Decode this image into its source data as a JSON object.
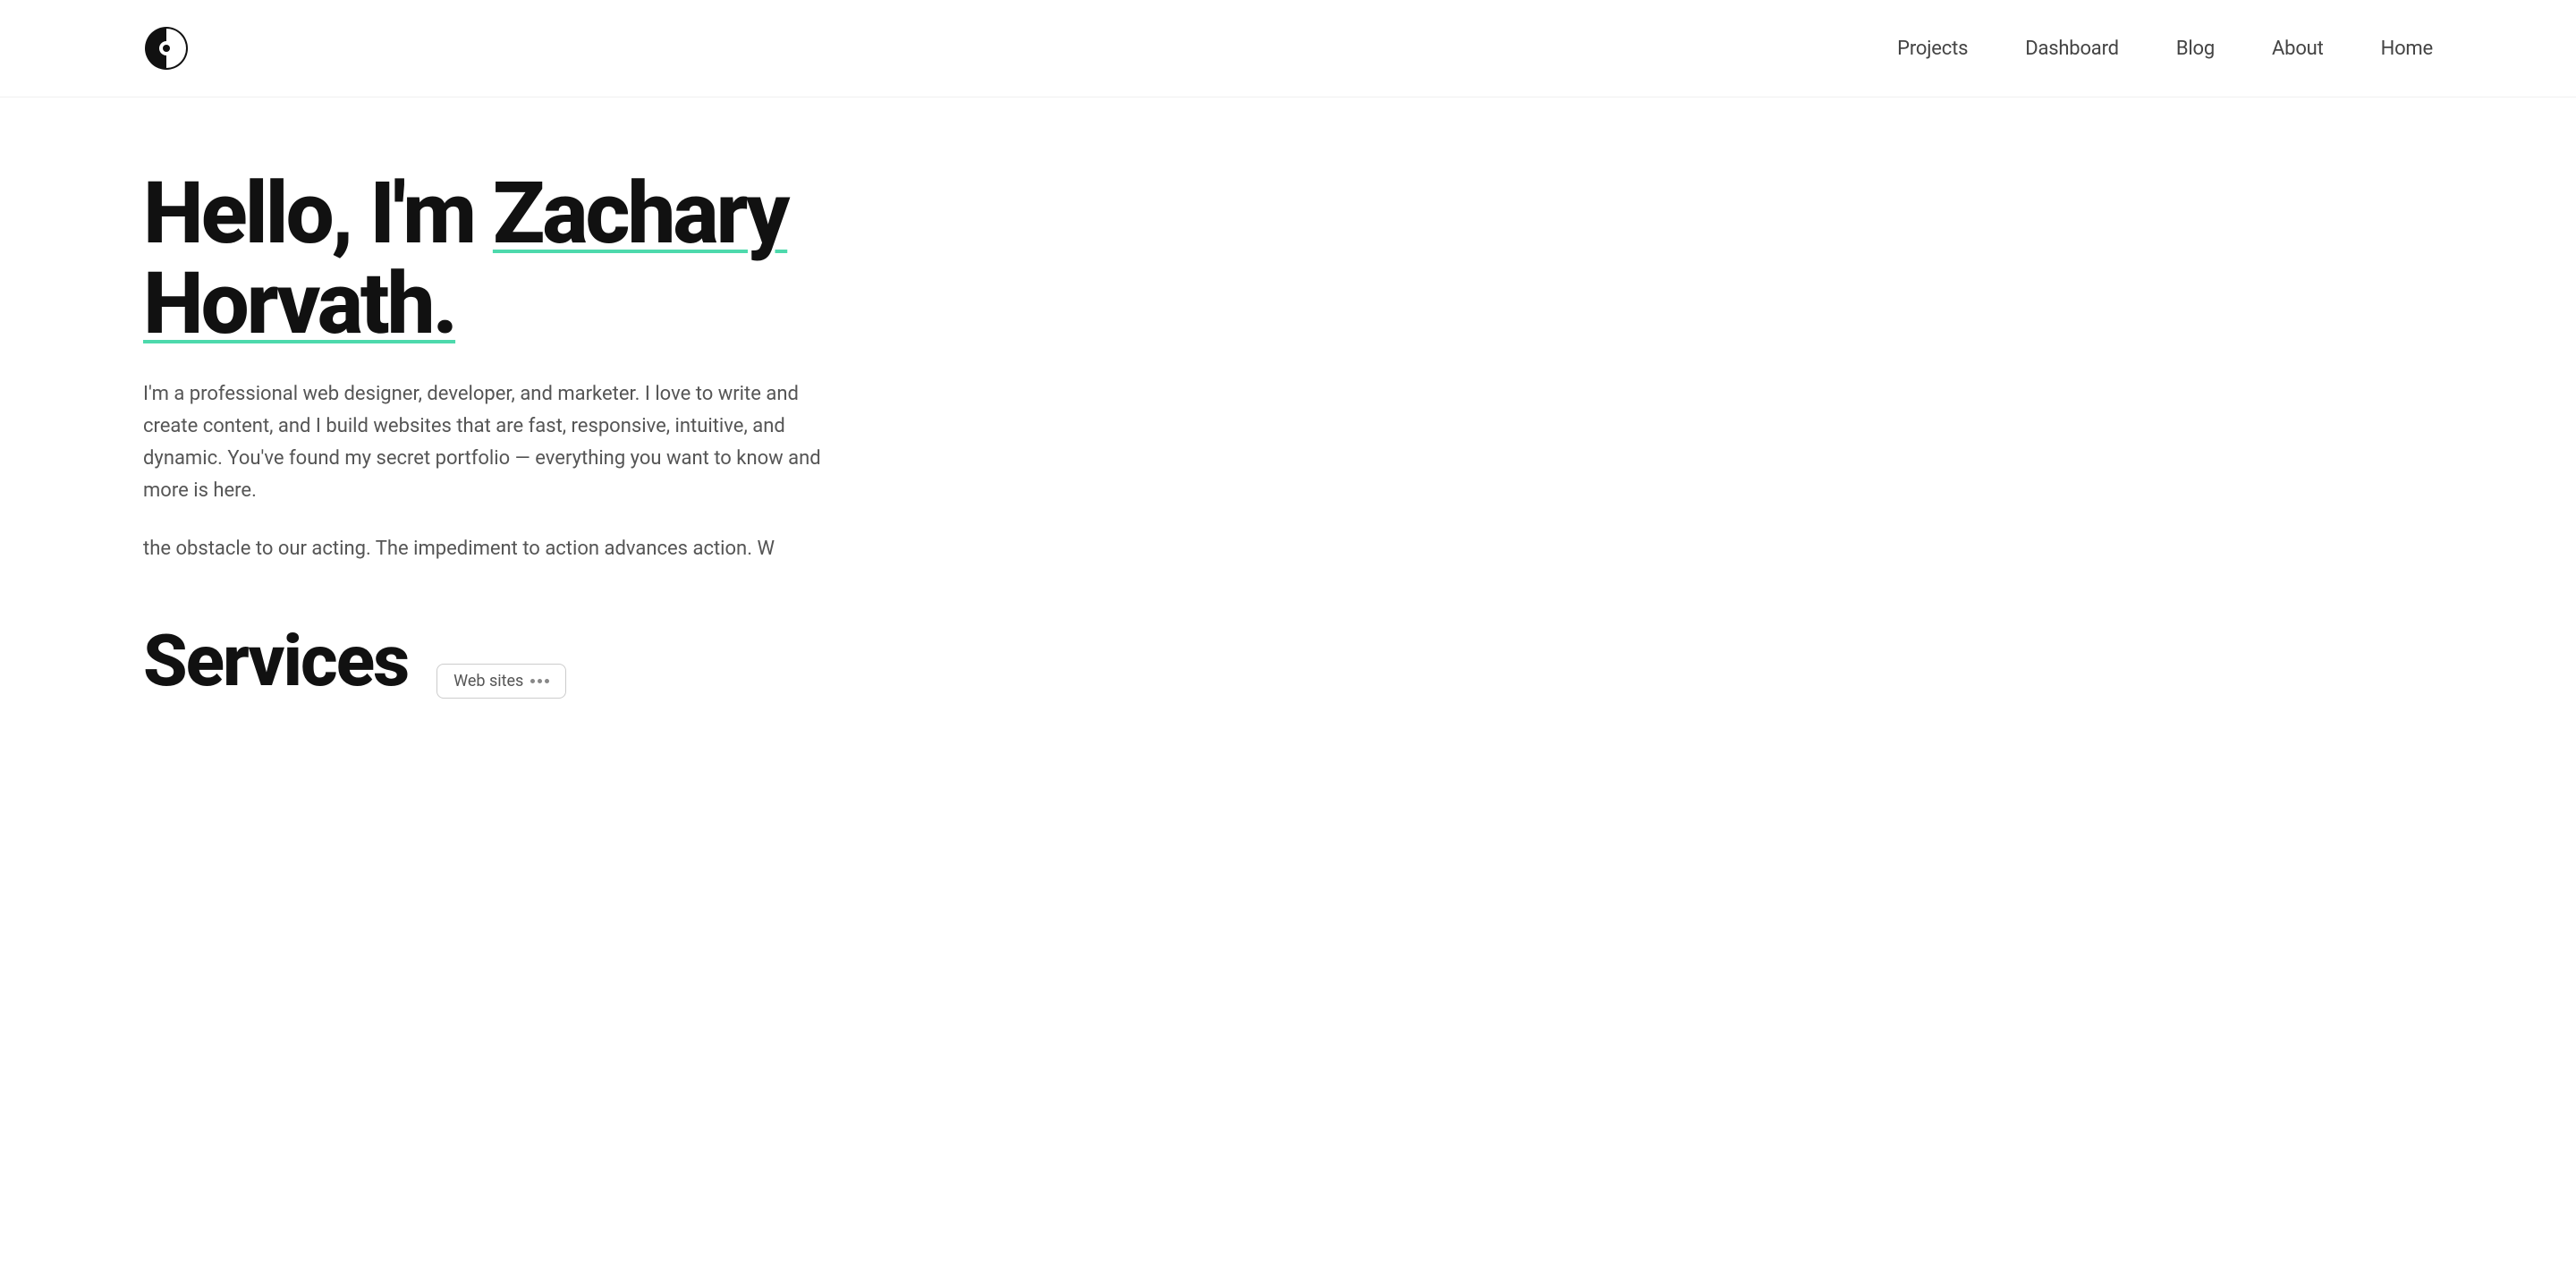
{
  "header": {
    "logo_alt": "Logo icon",
    "nav": {
      "items": [
        {
          "label": "Projects",
          "href": "#"
        },
        {
          "label": "Dashboard",
          "href": "#"
        },
        {
          "label": "Blog",
          "href": "#"
        },
        {
          "label": "About",
          "href": "#"
        },
        {
          "label": "Home",
          "href": "#"
        }
      ]
    }
  },
  "hero": {
    "title_line1": "Hello, I'm Zachary",
    "title_line2": "Horvath.",
    "description": "I'm a professional web designer, developer, and marketer. I love to write and create content, and I build websites that are fast, responsive, intuitive, and dynamic. You've found my secret portfolio — everything you want to know and more is here.",
    "quote": "the obstacle to our acting. The impediment to action advances action. W"
  },
  "services": {
    "title": "Services",
    "badge_label": "Web sites"
  },
  "colors": {
    "accent_underline": "#4dd9ac",
    "text_primary": "#111111",
    "text_secondary": "#555555",
    "nav_text": "#444444"
  }
}
